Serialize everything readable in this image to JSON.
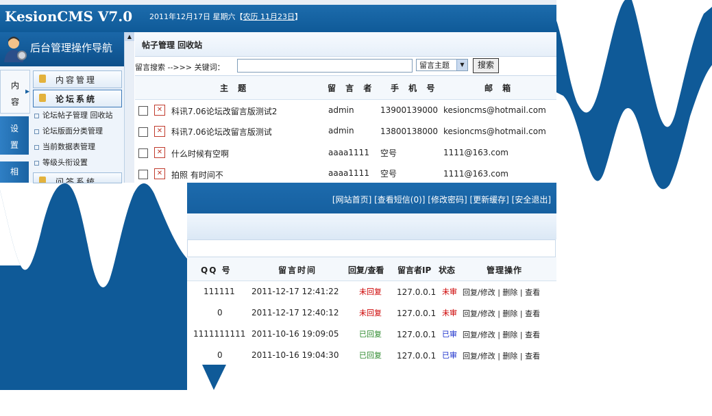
{
  "app": {
    "logo": "KesionCMS V7.0",
    "date_prefix": "2011年12月17日  星期六【",
    "lunar": "农历 11月23日",
    "date_suffix": "】"
  },
  "nav": {
    "title": "后台管理操作导航",
    "side_tabs": [
      "内容",
      "设置",
      "相"
    ],
    "menus": [
      "内容管理",
      "论坛系统",
      "问答系统"
    ],
    "sub_items": [
      "论坛帖子管理  回收站",
      "论坛版面分类管理",
      "当前数据表管理",
      "等级头衔设置"
    ]
  },
  "breadcrumb": "帖子管理  回收站",
  "search": {
    "label": "留言搜索  -->>> 关键词：",
    "value": "",
    "select": "留言主题",
    "button": "搜索"
  },
  "table_top": {
    "headers": [
      "主 题",
      "留 言 者",
      "手 机 号",
      "邮 箱"
    ],
    "rows": [
      {
        "subject": "科讯7.06论坛改留言版测试2",
        "author": "admin",
        "phone": "13900139000",
        "email": "kesioncms@hotmail.com"
      },
      {
        "subject": "科讯7.06论坛改留言版测试",
        "author": "admin",
        "phone": "13800138000",
        "email": "kesioncms@hotmail.com"
      },
      {
        "subject": "什么时候有空啊",
        "author": "aaaa1111",
        "phone": "空号",
        "email": "1111@163.com"
      },
      {
        "subject": "拍照 有时间不",
        "author": "aaaa1111",
        "phone": "空号",
        "email": "1111@163.com"
      }
    ]
  },
  "top_links": "[网站首页] [查看短信(0)] [修改密码] [更新缓存] [安全退出]",
  "table_bottom": {
    "headers": [
      "QQ 号",
      "留言时间",
      "回复/查看",
      "留言者IP",
      "状态",
      "管理操作"
    ],
    "rows": [
      {
        "qq": "111111",
        "time": "2011-12-17 12:41:22",
        "reply": "未回复",
        "ip": "127.0.0.1",
        "status": "未审",
        "actions": "回复/修改 | 删除 | 查看"
      },
      {
        "qq": "0",
        "time": "2011-12-17 12:40:12",
        "reply": "未回复",
        "ip": "127.0.0.1",
        "status": "未审",
        "actions": "回复/修改 | 删除 | 查看"
      },
      {
        "qq": "1111111111",
        "time": "2011-10-16 19:09:05",
        "reply": "已回复",
        "ip": "127.0.0.1",
        "status": "已审",
        "actions": "回复/修改 | 删除 | 查看"
      },
      {
        "qq": "0",
        "time": "2011-10-16 19:04:30",
        "reply": "已回复",
        "ip": "127.0.0.1",
        "status": "已审",
        "actions": "回复/修改 | 删除 | 查看"
      }
    ]
  },
  "colors": {
    "brand": "#0f5a98",
    "zigzag": "#0f5a98",
    "unreplied": "#cc0000",
    "replied": "#2e8a2e",
    "approved": "#1a2fcc"
  }
}
